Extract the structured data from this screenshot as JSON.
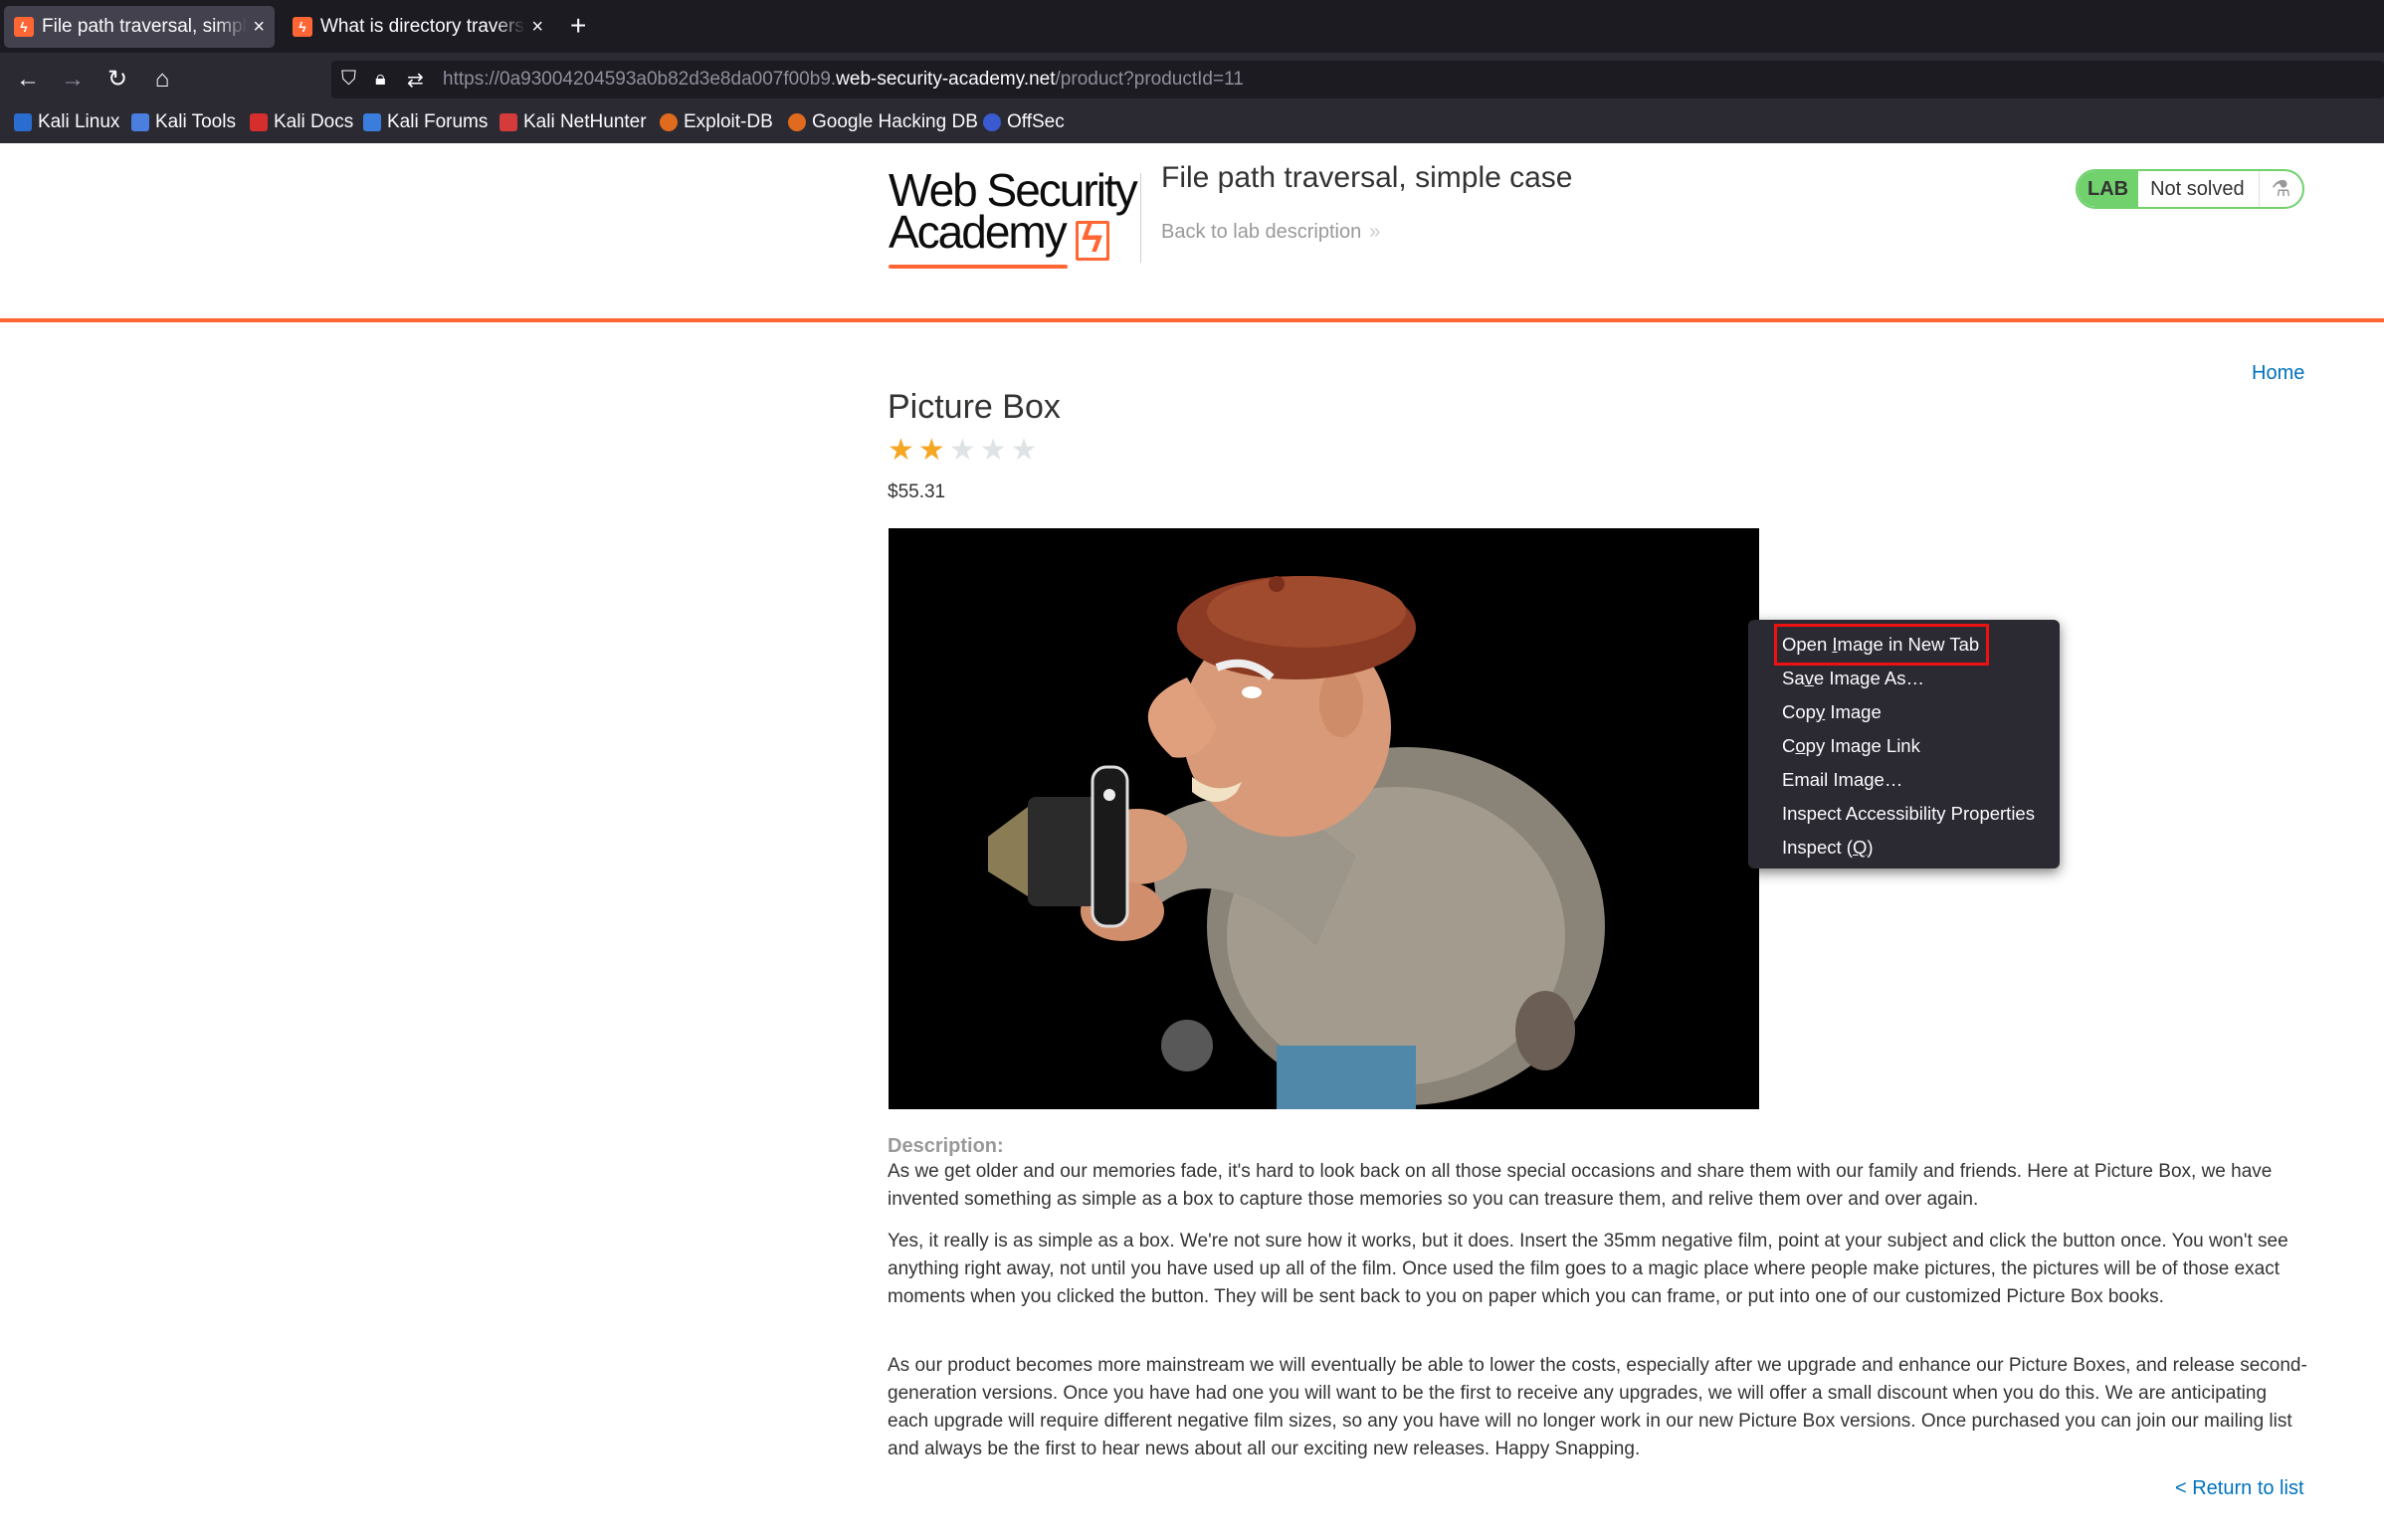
{
  "browser": {
    "tabs": [
      {
        "title": "File path traversal, simple case",
        "active": true
      },
      {
        "title": "What is directory traversal?",
        "active": false
      }
    ],
    "url": {
      "prefix": "https://0a93004204593a0b82d3e8da007f00b9.",
      "host": "web-security-academy.net",
      "path": "/product?productId=11"
    },
    "bookmarks": [
      "Kali Linux",
      "Kali Tools",
      "Kali Docs",
      "Kali Forums",
      "Kali NetHunter",
      "Exploit-DB",
      "Google Hacking DB",
      "OffSec"
    ]
  },
  "lab": {
    "logo_line1": "Web Security",
    "logo_line2": "Academy",
    "title": "File path traversal, simple case",
    "back_link": "Back to lab description",
    "badge": "LAB",
    "status": "Not solved"
  },
  "product": {
    "home_link": "Home",
    "title": "Picture Box",
    "rating": 2,
    "rating_max": 5,
    "price": "$55.31",
    "description_label": "Description:",
    "paragraphs": [
      "As we get older and our memories fade, it's hard to look back on all those special occasions and share them with our family and friends. Here at Picture Box, we have invented something as simple as a box to capture those memories so you can treasure them, and relive them over and over again.",
      "Yes, it really is as simple as a box. We're not sure how it works, but it does. Insert the 35mm negative film, point at your subject and click the button once. You won't see anything right away, not until you have used up all of the film. Once used the film goes to a magic place where people make pictures, the pictures will be of those exact moments when you clicked the button. They will be sent back to you on paper which you can frame, or put into one of our customized Picture Box books.",
      "As our product becomes more mainstream we will eventually be able to lower the costs, especially after we upgrade and enhance our Picture Boxes, and release second-generation versions. Once you have had one you will want to be the first to receive any upgrades, we will offer a small discount when you do this. We are anticipating each upgrade will require different negative film sizes, so any you have will no longer work in our new Picture Box versions. Once purchased you can join our mailing list and always be the first to hear news about all our exciting new releases. Happy Snapping."
    ],
    "return_link": "< Return to list"
  },
  "context_menu": {
    "items": [
      {
        "before": "Open ",
        "key": "I",
        "after": "mage in New Tab",
        "highlighted": true
      },
      {
        "before": "Sa",
        "key": "v",
        "after": "e Image As…"
      },
      {
        "before": "Cop",
        "key": "y",
        "after": " Image"
      },
      {
        "before": "C",
        "key": "o",
        "after": "py Image Link"
      },
      {
        "before": "Email Image…",
        "key": "",
        "after": ""
      },
      {
        "before": "Inspect Accessibility Properties",
        "key": "",
        "after": ""
      },
      {
        "before": "Inspect (",
        "key": "Q",
        "after": ")"
      }
    ]
  },
  "colors": {
    "accent": "#ff6633",
    "link": "#0071bc",
    "lab_green": "#70d16d",
    "highlight_box": "#e11111"
  }
}
